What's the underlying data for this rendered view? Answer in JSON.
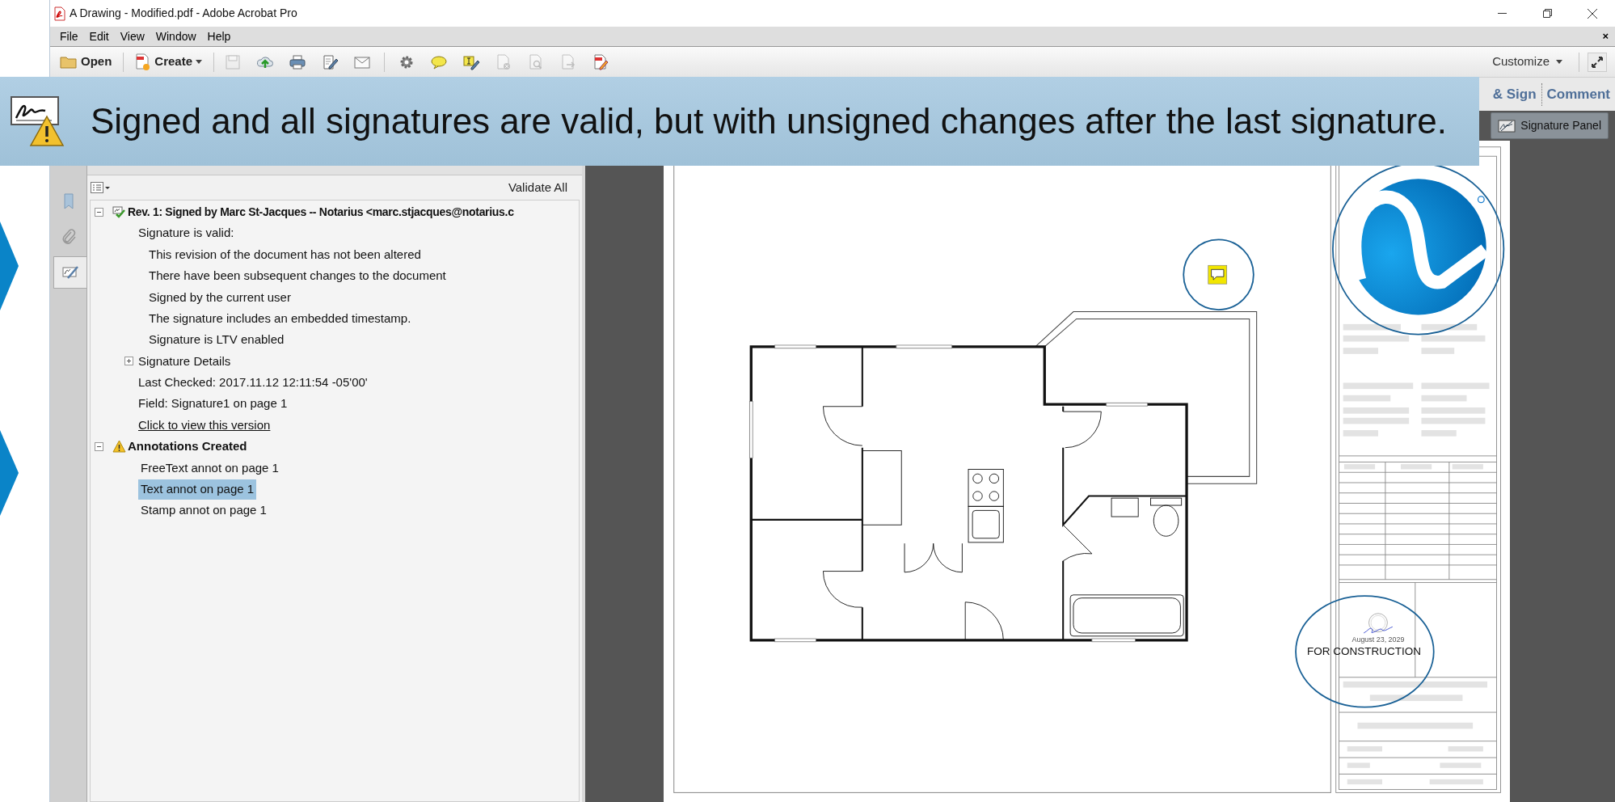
{
  "window": {
    "title": "A Drawing - Modified.pdf - Adobe Acrobat Pro"
  },
  "menu": {
    "items": [
      "File",
      "Edit",
      "View",
      "Window",
      "Help"
    ],
    "close_glyph": "×"
  },
  "toolbar": {
    "open": "Open",
    "create": "Create",
    "customize": "Customize",
    "icons": [
      {
        "kind": "save",
        "disabled": true
      },
      {
        "kind": "upload",
        "disabled": false
      },
      {
        "kind": "print",
        "disabled": false
      },
      {
        "kind": "edit",
        "disabled": false
      },
      {
        "kind": "mail",
        "disabled": false
      },
      {
        "kind": "gear",
        "disabled": false
      },
      {
        "kind": "comment",
        "disabled": false
      },
      {
        "kind": "highlight",
        "disabled": false
      },
      {
        "kind": "doc-remove",
        "disabled": true
      },
      {
        "kind": "doc-search",
        "disabled": true
      },
      {
        "kind": "doc-export",
        "disabled": true
      },
      {
        "kind": "doc-edit",
        "disabled": false
      }
    ]
  },
  "task_tabs": [
    "& Sign",
    "Comment"
  ],
  "banner": {
    "message": "Signed and all signatures are valid, but with unsigned changes after the last signature."
  },
  "nav_tabs": [
    {
      "kind": "bookmark",
      "selected": false
    },
    {
      "kind": "attachment",
      "selected": false
    },
    {
      "kind": "signature",
      "selected": true
    }
  ],
  "signature_panel": {
    "validate_all": "Validate All",
    "tree": [
      {
        "label": "Rev. 1: Signed by Marc St-Jacques -- Notarius <marc.stjacques@notarius.c",
        "kind": "signature",
        "expanded": true,
        "children": [
          {
            "label": "Signature is valid:",
            "children": [
              {
                "label": "This revision of the document has not been altered"
              },
              {
                "label": "There have been subsequent changes to the document"
              },
              {
                "label": "Signed by the current user"
              },
              {
                "label": "The signature includes an embedded timestamp."
              },
              {
                "label": "Signature is LTV enabled"
              }
            ]
          },
          {
            "label": "Signature Details",
            "expanded": false
          },
          {
            "label": "Last Checked: 2017.11.12 12:11:54 -05'00'"
          },
          {
            "label": "Field: Signature1 on page 1"
          },
          {
            "label": "Click to view this version",
            "kind": "link"
          }
        ]
      },
      {
        "label": "Annotations Created",
        "kind": "warning",
        "expanded": true,
        "children": [
          {
            "label": "FreeText annot on page 1",
            "kind": "annotation",
            "selected": false
          },
          {
            "label": "Text annot on page 1",
            "kind": "annotation",
            "selected": true
          },
          {
            "label": "Stamp annot on page 1",
            "kind": "annotation",
            "selected": false
          }
        ]
      }
    ]
  },
  "document": {
    "signature_panel_button": "Signature Panel",
    "stamp_date": "August 23, 2029",
    "stamp_caption": "FOR CONSTRUCTION"
  }
}
